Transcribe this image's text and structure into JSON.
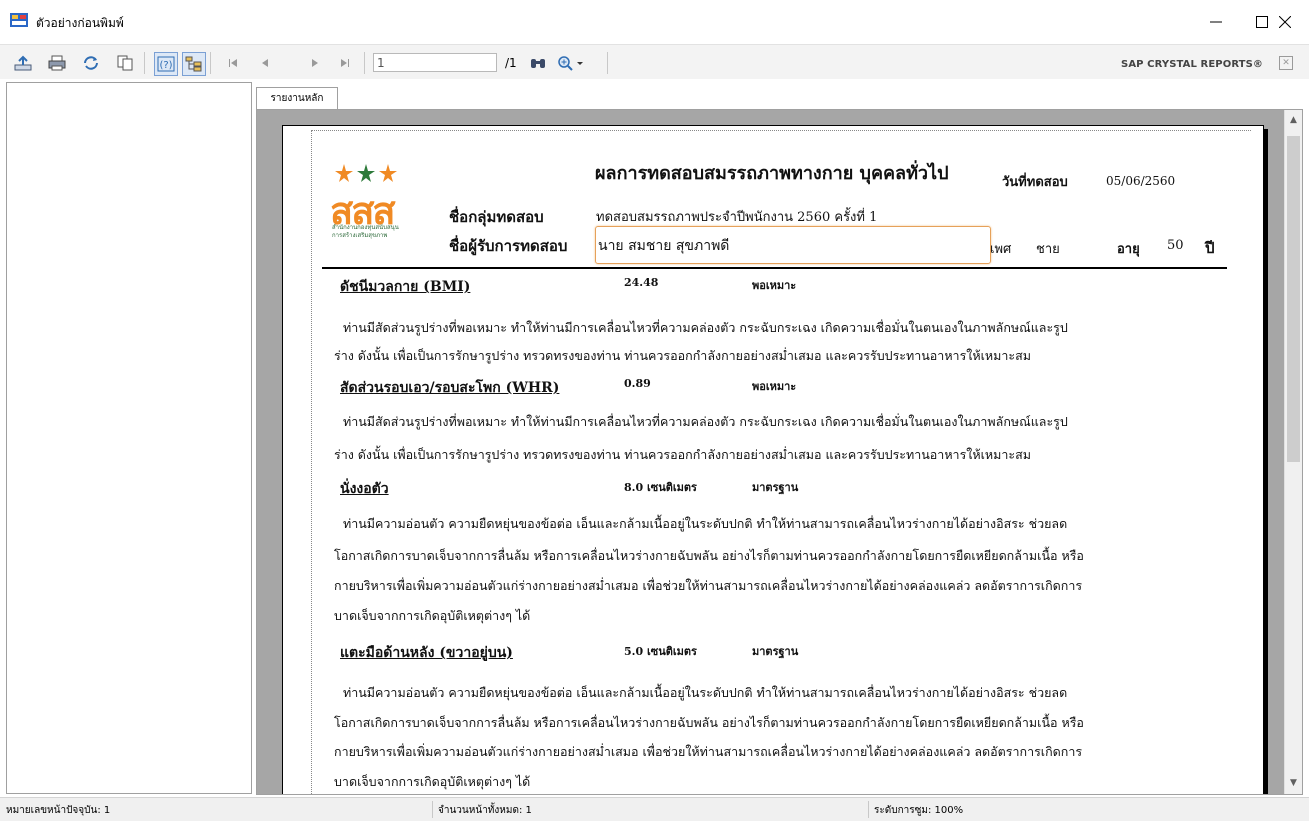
{
  "window": {
    "title": "ตัวอย่างก่อนพิมพ์"
  },
  "toolbar": {
    "page_current": "1",
    "page_total": "/1",
    "brand": "SAP CRYSTAL REPORTS®"
  },
  "tab": {
    "label": "รายงานหลัก"
  },
  "report": {
    "logo_text": "สสส",
    "logo_sub1": "สำนักงานกองทุนสนับสนุน",
    "logo_sub2": "การสร้างเสริมสุขภาพ",
    "title": "ผลการทดสอบสมรรถภาพทางกาย บุคคลทั่วไป",
    "test_date_label": "วันที่ทดสอบ",
    "test_date": "05/06/2560",
    "group_label": "ชื่อกลุ่มทดสอบ",
    "group_value": "ทดสอบสมรรถภาพประจำปีพนักงาน 2560 ครั้งที่ 1",
    "name_label": "ชื่อผู้รับการทดสอบ",
    "name_value": "นาย สมชาย สุขภาพดี",
    "sex_label": "เพศ",
    "sex_value": "ชาย",
    "age_label": "อายุ",
    "age_value": "50",
    "age_unit": "ปี",
    "sections": [
      {
        "title": "ดัชนีมวลกาย (BMI)",
        "value": "24.48",
        "result": "พอเหมาะ",
        "lines": [
          "ท่านมีสัดส่วนรูปร่างที่พอเหมาะ  ทำให้ท่านมีการเคลื่อนไหวที่ความคล่องตัว กระฉับกระเฉง เกิดความเชื่อมั่นในตนเองในภาพลักษณ์และรูป",
          "ร่าง ดังนั้น เพื่อเป็นการรักษารูปร่าง ทรวดทรงของท่าน ท่านควรออกกำลังกายอย่างสม่ำเสมอ และควรรับประทานอาหารให้เหมาะสม"
        ]
      },
      {
        "title": "สัดส่วนรอบเอว/รอบสะโพก (WHR)",
        "value": "0.89",
        "result": "พอเหมาะ",
        "lines": [
          "ท่านมีสัดส่วนรูปร่างที่พอเหมาะ  ทำให้ท่านมีการเคลื่อนไหวที่ความคล่องตัว กระฉับกระเฉง เกิดความเชื่อมั่นในตนเองในภาพลักษณ์และรูป",
          "ร่าง ดังนั้น เพื่อเป็นการรักษารูปร่าง ทรวดทรงของท่าน ท่านควรออกกำลังกายอย่างสม่ำเสมอ และควรรับประทานอาหารให้เหมาะสม"
        ]
      },
      {
        "title": "นั่งงอตัว",
        "value": "8.0 เซนติเมตร",
        "result": "มาตรฐาน",
        "lines": [
          "ท่านมีความอ่อนตัว  ความยืดหยุ่นของข้อต่อ  เอ็นและกล้ามเนื้ออยู่ในระดับปกติ  ทำให้ท่านสามารถเคลื่อนไหวร่างกายได้อย่างอิสระ  ช่วยลด",
          "โอกาสเกิดการบาดเจ็บจากการลื่นล้ม  หรือการเคลื่อนไหวร่างกายฉับพลัน  อย่างไรก็ตามท่านควรออกกำลังกายโดยการยืดเหยียดกล้ามเนื้อ  หรือ",
          "กายบริหารเพื่อเพิ่มความอ่อนตัวแก่ร่างกายอย่างสม่ำเสมอ   เพื่อช่วยให้ท่านสามารถเคลื่อนไหวร่างกายได้อย่างคล่องแคล่ว  ลดอัตราการเกิดการ",
          "บาดเจ็บจากการเกิดอุบัติเหตุต่างๆ  ได้"
        ]
      },
      {
        "title": "แตะมือด้านหลัง (ขวาอยู่บน)",
        "value": "5.0 เซนติเมตร",
        "result": "มาตรฐาน",
        "lines": [
          "ท่านมีความอ่อนตัว  ความยืดหยุ่นของข้อต่อ  เอ็นและกล้ามเนื้ออยู่ในระดับปกติ  ทำให้ท่านสามารถเคลื่อนไหวร่างกายได้อย่างอิสระ  ช่วยลด",
          "โอกาสเกิดการบาดเจ็บจากการลื่นล้ม  หรือการเคลื่อนไหวร่างกายฉับพลัน  อย่างไรก็ตามท่านควรออกกำลังกายโดยการยืดเหยียดกล้ามเนื้อ  หรือ",
          "กายบริหารเพื่อเพิ่มความอ่อนตัวแก่ร่างกายอย่างสม่ำเสมอ   เพื่อช่วยให้ท่านสามารถเคลื่อนไหวร่างกายได้อย่างคล่องแคล่ว  ลดอัตราการเกิดการ",
          "บาดเจ็บจากการเกิดอุบัติเหตุต่างๆ  ได้"
        ]
      }
    ]
  },
  "status": {
    "current_page": "หมายเลขหน้าปัจจุบัน: 1",
    "total_pages": "จำนวนหน้าทั้งหมด: 1",
    "zoom": "ระดับการซูม: 100%"
  },
  "colors": {
    "logo": "#f08a24",
    "name_box_border": "#e6a15a",
    "viewer_bg": "#a6a6a6"
  },
  "icons": [
    "export-icon",
    "print-icon",
    "refresh-icon",
    "copy-icon",
    "help-icon",
    "group-tree-icon",
    "first-page-icon",
    "prev-page-icon",
    "next-page-icon",
    "last-page-icon",
    "find-icon",
    "zoom-icon"
  ]
}
